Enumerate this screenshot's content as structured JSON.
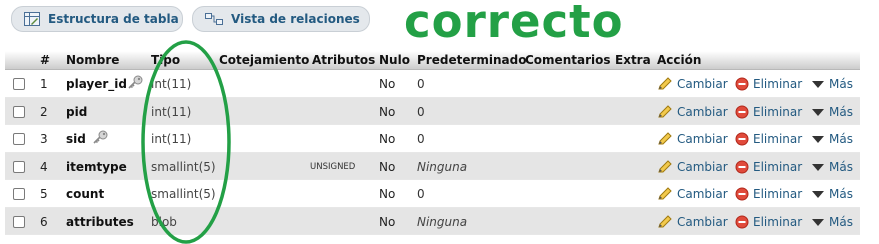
{
  "tabs": {
    "structure_label": "Estructura de tabla",
    "relations_label": "Vista de relaciones"
  },
  "annotation": {
    "word": "correcto",
    "color": "#23a046"
  },
  "table": {
    "headers": {
      "num": "#",
      "name": "Nombre",
      "type": "Tipo",
      "collation": "Cotejamiento",
      "attributes": "Atributos",
      "null": "Nulo",
      "default": "Predeterminado",
      "comments": "Comentarios",
      "extra": "Extra",
      "action": "Acción"
    },
    "actions": {
      "change": "Cambiar",
      "drop": "Eliminar",
      "more": "Más"
    },
    "rows": [
      {
        "num": "1",
        "name": "player_id",
        "type": "int(11)",
        "attributes": "",
        "null": "No",
        "default": "0",
        "default_italic": false,
        "key_icon": true
      },
      {
        "num": "2",
        "name": "pid",
        "type": "int(11)",
        "attributes": "",
        "null": "No",
        "default": "0",
        "default_italic": false,
        "key_icon": false
      },
      {
        "num": "3",
        "name": "sid",
        "type": "int(11)",
        "attributes": "",
        "null": "No",
        "default": "0",
        "default_italic": false,
        "key_icon": true
      },
      {
        "num": "4",
        "name": "itemtype",
        "type": "smallint(5)",
        "attributes": "UNSIGNED",
        "null": "No",
        "default": "Ninguna",
        "default_italic": true,
        "key_icon": false
      },
      {
        "num": "5",
        "name": "count",
        "type": "smallint(5)",
        "attributes": "",
        "null": "No",
        "default": "0",
        "default_italic": false,
        "key_icon": false
      },
      {
        "num": "6",
        "name": "attributes",
        "type": "blob",
        "attributes": "",
        "null": "No",
        "default": "Ninguna",
        "default_italic": true,
        "key_icon": false
      }
    ]
  }
}
